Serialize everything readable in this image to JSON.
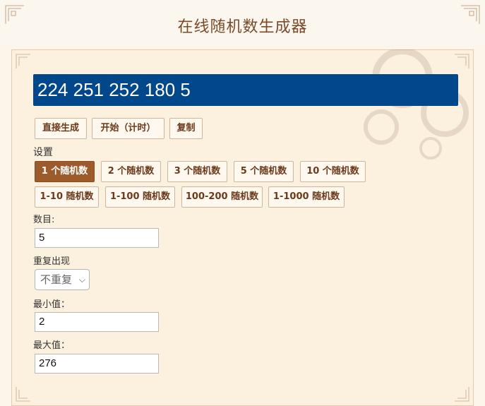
{
  "header": {
    "title": "在线随机数生成器"
  },
  "result": {
    "text": "224 251 252 180 5"
  },
  "actions": [
    {
      "label": "直接生成"
    },
    {
      "label": "开始（计时）"
    },
    {
      "label": "复制"
    }
  ],
  "settings": {
    "title": "设置",
    "count_presets": [
      "1 个随机数",
      "2 个随机数",
      "3 个随机数",
      "5 个随机数",
      "10 个随机数"
    ],
    "range_presets": [
      "1-10 随机数",
      "1-100 随机数",
      "100-200 随机数",
      "1-1000 随机数"
    ],
    "active_preset": "1 个随机数",
    "count_label": "数目:",
    "count_value": "5",
    "repeat_label": "重复出现",
    "repeat_value": "不重复",
    "min_label": "最小值：",
    "min_value": "2",
    "max_label": "最大值：",
    "max_value": "276"
  },
  "colors": {
    "accent": "#9d5a2a",
    "result_bg": "#00478c",
    "title": "#7a4a2a"
  }
}
